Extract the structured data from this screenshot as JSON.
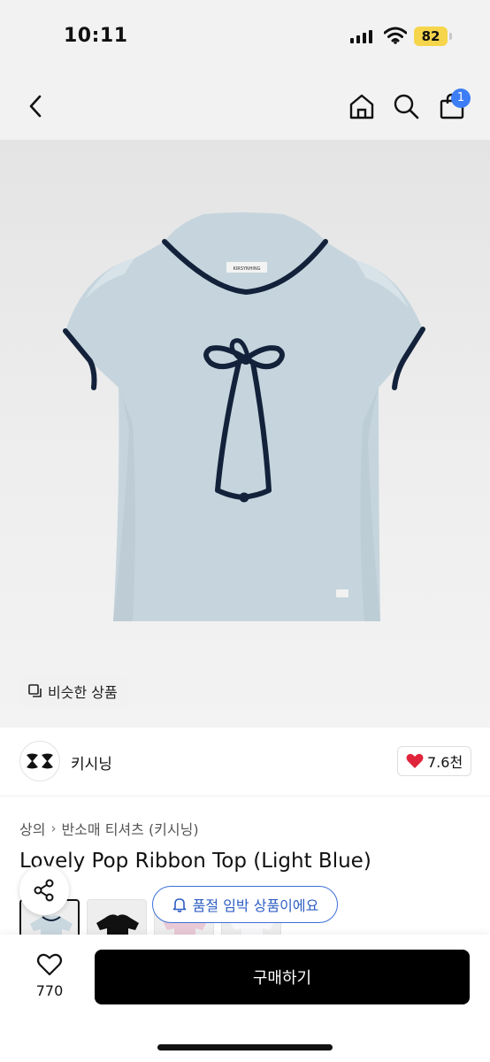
{
  "status_bar": {
    "time": "10:11",
    "battery": "82",
    "battery_color": "#f6d54b"
  },
  "nav": {
    "cart_badge": "1",
    "badge_color": "#3d7df5"
  },
  "hero": {
    "similar_label": "비슷한 상품",
    "label_tag": "KIRSYNHING"
  },
  "store": {
    "name": "키시닝",
    "likes": "7.6천"
  },
  "breadcrumb": {
    "level1": "상의",
    "level2": "반소매 티셔츠 (키시닝)"
  },
  "product": {
    "title": "Lovely Pop Ribbon Top (Light Blue)"
  },
  "thumbnails": [
    {
      "name": "light-blue",
      "color": "#c9d7df"
    },
    {
      "name": "black",
      "color": "#111111"
    },
    {
      "name": "pink",
      "color": "#e9c9d6"
    },
    {
      "name": "white",
      "color": "#f4f4f6"
    }
  ],
  "stock_notice": "품절 임박 상품이에요",
  "bottom": {
    "wish_count": "770",
    "buy_label": "구매하기"
  },
  "colors": {
    "shirt": "#c6d5dd",
    "trim": "#13223a",
    "accent_blue": "#3d6fd8",
    "heart_red": "#e0243b"
  }
}
